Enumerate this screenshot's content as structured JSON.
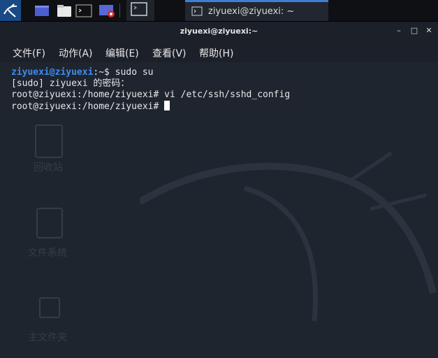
{
  "taskbar": {
    "task_title": "ziyuexi@ziyuexi: ~",
    "icons": [
      "kali-menu-icon",
      "window-icon",
      "folder-icon",
      "terminal-icon",
      "screen-recorder-icon"
    ],
    "accent": "#3d7fd6"
  },
  "window": {
    "title": "ziyuexi@ziyuexi:~",
    "buttons": {
      "minimize": "–",
      "maximize": "□",
      "close": "✕"
    }
  },
  "menu": {
    "items": [
      "文件(F)",
      "动作(A)",
      "编辑(E)",
      "查看(V)",
      "帮助(H)"
    ]
  },
  "terminal": {
    "line1": {
      "user_host": "ziyuexi@ziyuexi",
      "rest": ":~$ sudo su"
    },
    "line2": "[sudo] ziyuexi 的密码：",
    "line3": "root@ziyuexi:/home/ziyuexi# vi /etc/ssh/sshd_config",
    "line4": "root@ziyuexi:/home/ziyuexi# ",
    "prompt_color": "#3e8bf3"
  },
  "desktop": {
    "trash_label": "回收站",
    "filesystem_label": "文件系统",
    "home_label": "主文件夹"
  }
}
